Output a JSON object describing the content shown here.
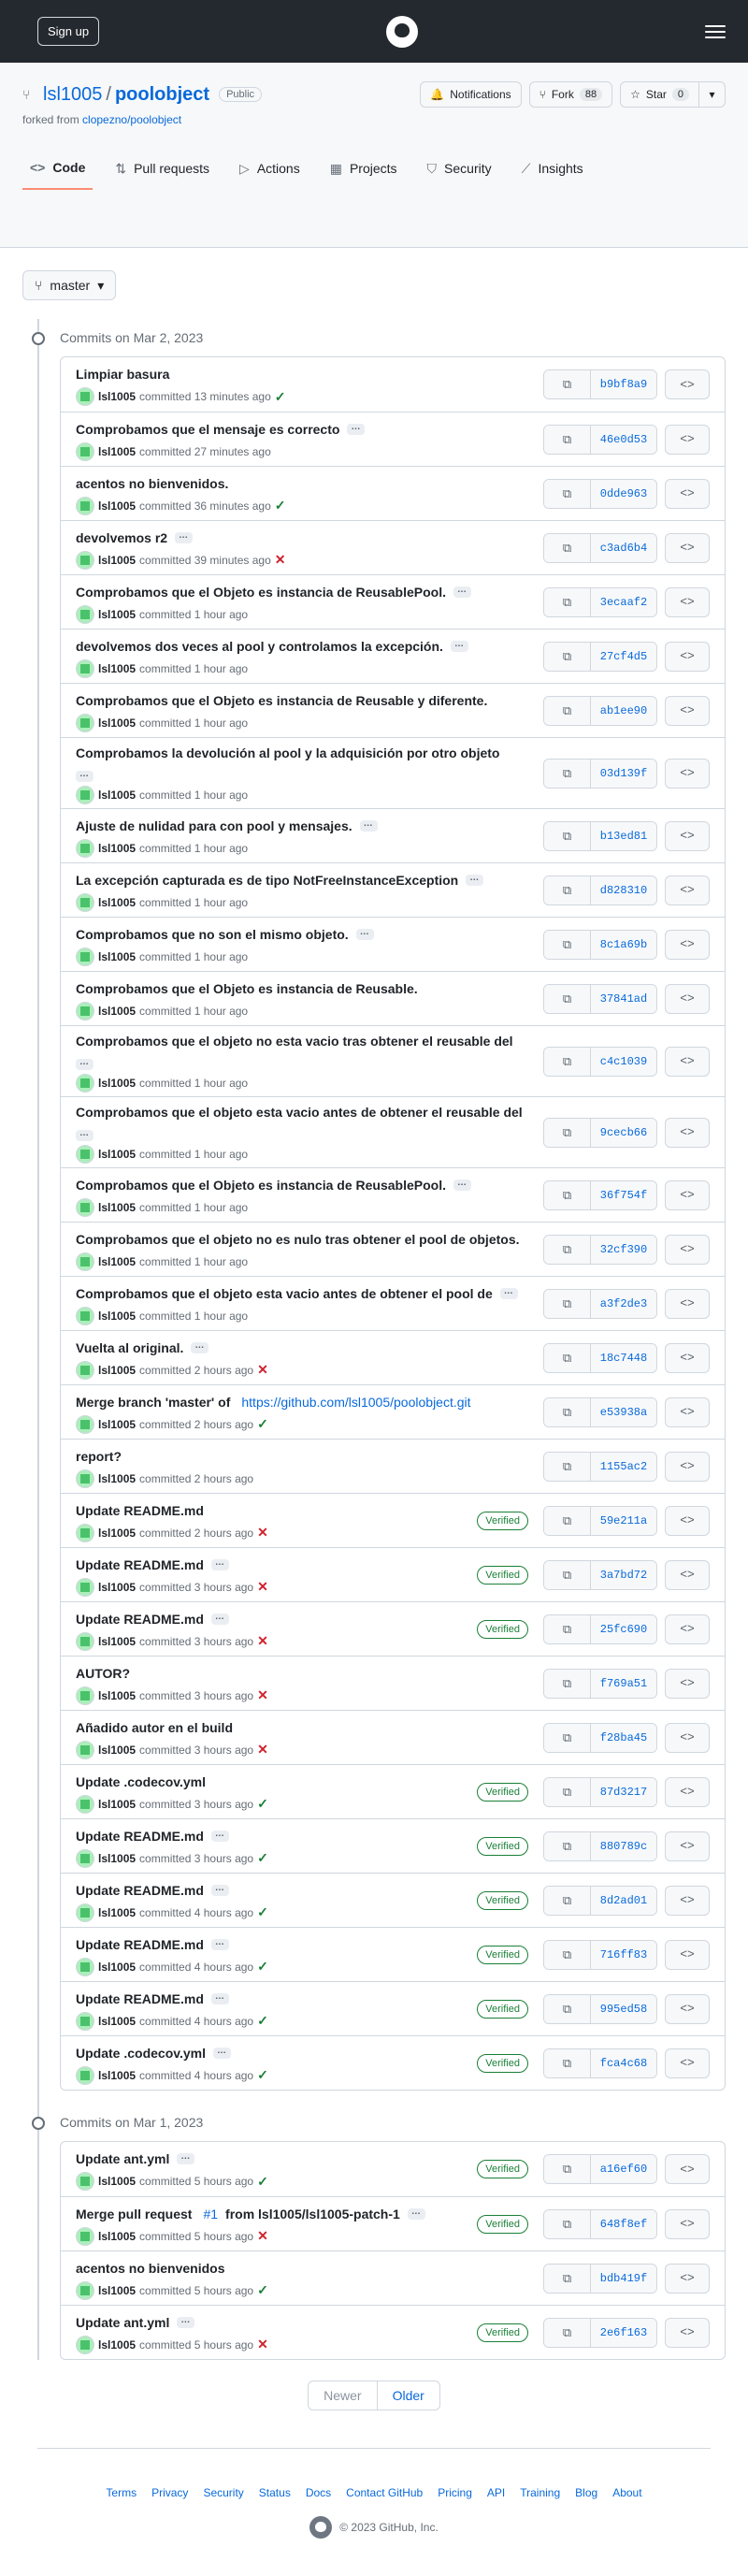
{
  "topbar": {
    "signup": "Sign up"
  },
  "repo": {
    "owner": "lsl1005",
    "separator": "/",
    "name": "poolobject",
    "visibility": "Public",
    "forked_label": "forked from",
    "forked_from": "clopezno/poolobject",
    "notifications": "Notifications",
    "fork": "Fork",
    "fork_count": "88",
    "star": "Star",
    "star_count": "0"
  },
  "tabs": [
    "Code",
    "Pull requests",
    "Actions",
    "Projects",
    "Security",
    "Insights"
  ],
  "branch": "master",
  "groups": [
    {
      "date": "Commits on Mar 2, 2023",
      "commits": [
        {
          "msg": "Limpiar basura",
          "author": "lsl1005",
          "time": "committed 13 minutes ago",
          "status": "ok",
          "sha": "b9bf8a9",
          "ell": false,
          "verified": ""
        },
        {
          "msg": "Comprobamos que el mensaje es correcto",
          "author": "lsl1005",
          "time": "committed 27 minutes ago",
          "status": "",
          "sha": "46e0d53",
          "ell": true,
          "verified": ""
        },
        {
          "msg": "acentos no bienvenidos.",
          "author": "lsl1005",
          "time": "committed 36 minutes ago",
          "status": "ok",
          "sha": "0dde963",
          "ell": false,
          "verified": ""
        },
        {
          "msg": "devolvemos r2",
          "author": "lsl1005",
          "time": "committed 39 minutes ago",
          "status": "fail",
          "sha": "c3ad6b4",
          "ell": true,
          "verified": ""
        },
        {
          "msg": "Comprobamos que el Objeto es instancia de ReusablePool.",
          "author": "lsl1005",
          "time": "committed 1 hour ago",
          "status": "",
          "sha": "3ecaaf2",
          "ell": true,
          "verified": ""
        },
        {
          "msg": "devolvemos dos veces al pool y controlamos la excepción.",
          "author": "lsl1005",
          "time": "committed 1 hour ago",
          "status": "",
          "sha": "27cf4d5",
          "ell": true,
          "verified": ""
        },
        {
          "msg": "Comprobamos que el Objeto es instancia de Reusable y diferente.",
          "author": "lsl1005",
          "time": "committed 1 hour ago",
          "status": "",
          "sha": "ab1ee90",
          "ell": false,
          "verified": ""
        },
        {
          "msg": "Comprobamos la devolución al pool y la adquisición por otro objeto",
          "author": "lsl1005",
          "time": "committed 1 hour ago",
          "status": "",
          "sha": "03d139f",
          "ell": true,
          "wrap": true,
          "verified": ""
        },
        {
          "msg": "Ajuste de nulidad para con pool y mensajes.",
          "author": "lsl1005",
          "time": "committed 1 hour ago",
          "status": "",
          "sha": "b13ed81",
          "ell": true,
          "verified": ""
        },
        {
          "msg": "La excepción capturada es de tipo NotFreeInstanceException",
          "author": "lsl1005",
          "time": "committed 1 hour ago",
          "status": "",
          "sha": "d828310",
          "ell": true,
          "verified": ""
        },
        {
          "msg": "Comprobamos que no son el mismo objeto.",
          "author": "lsl1005",
          "time": "committed 1 hour ago",
          "status": "",
          "sha": "8c1a69b",
          "ell": true,
          "verified": ""
        },
        {
          "msg": "Comprobamos que el Objeto es instancia de Reusable.",
          "author": "lsl1005",
          "time": "committed 1 hour ago",
          "status": "",
          "sha": "37841ad",
          "ell": false,
          "verified": ""
        },
        {
          "msg": "Comprobamos que el objeto no esta vacio tras obtener el reusable del",
          "author": "lsl1005",
          "time": "committed 1 hour ago",
          "status": "",
          "sha": "c4c1039",
          "ell": true,
          "wrap": true,
          "verified": ""
        },
        {
          "msg": "Comprobamos que el objeto esta vacio antes de obtener el reusable del",
          "author": "lsl1005",
          "time": "committed 1 hour ago",
          "status": "",
          "sha": "9cecb66",
          "ell": true,
          "wrap": true,
          "verified": ""
        },
        {
          "msg": "Comprobamos que el Objeto es instancia de ReusablePool.",
          "author": "lsl1005",
          "time": "committed 1 hour ago",
          "status": "",
          "sha": "36f754f",
          "ell": true,
          "verified": ""
        },
        {
          "msg": "Comprobamos que el objeto no es nulo tras obtener el pool de objetos.",
          "author": "lsl1005",
          "time": "committed 1 hour ago",
          "status": "",
          "sha": "32cf390",
          "ell": false,
          "verified": ""
        },
        {
          "msg": "Comprobamos que el objeto esta vacio antes de obtener el pool de",
          "author": "lsl1005",
          "time": "committed 1 hour ago",
          "status": "",
          "sha": "a3f2de3",
          "ell": true,
          "verified": ""
        },
        {
          "msg": "Vuelta al original.",
          "author": "lsl1005",
          "time": "committed 2 hours ago",
          "status": "fail",
          "sha": "18c7448",
          "ell": true,
          "verified": ""
        },
        {
          "msg": "Merge branch 'master' of",
          "link": "https://github.com/lsl1005/poolobject.git",
          "author": "lsl1005",
          "time": "committed 2 hours ago",
          "status": "ok",
          "sha": "e53938a",
          "ell": false,
          "verified": ""
        },
        {
          "msg": "report?",
          "author": "lsl1005",
          "time": "committed 2 hours ago",
          "status": "",
          "sha": "1155ac2",
          "ell": false,
          "verified": ""
        },
        {
          "msg": "Update README.md",
          "author": "lsl1005",
          "time": "committed 2 hours ago",
          "status": "fail",
          "sha": "59e211a",
          "ell": false,
          "verified": "Verified"
        },
        {
          "msg": "Update README.md",
          "author": "lsl1005",
          "time": "committed 3 hours ago",
          "status": "fail",
          "sha": "3a7bd72",
          "ell": true,
          "verified": "Verified"
        },
        {
          "msg": "Update README.md",
          "author": "lsl1005",
          "time": "committed 3 hours ago",
          "status": "fail",
          "sha": "25fc690",
          "ell": true,
          "verified": "Verified"
        },
        {
          "msg": "AUTOR?",
          "author": "lsl1005",
          "time": "committed 3 hours ago",
          "status": "fail",
          "sha": "f769a51",
          "ell": false,
          "verified": ""
        },
        {
          "msg": "Añadido autor en el build",
          "author": "lsl1005",
          "time": "committed 3 hours ago",
          "status": "fail",
          "sha": "f28ba45",
          "ell": false,
          "verified": ""
        },
        {
          "msg": "Update .codecov.yml",
          "author": "lsl1005",
          "time": "committed 3 hours ago",
          "status": "ok",
          "sha": "87d3217",
          "ell": false,
          "verified": "Verified"
        },
        {
          "msg": "Update README.md",
          "author": "lsl1005",
          "time": "committed 3 hours ago",
          "status": "ok",
          "sha": "880789c",
          "ell": true,
          "verified": "Verified"
        },
        {
          "msg": "Update README.md",
          "author": "lsl1005",
          "time": "committed 4 hours ago",
          "status": "ok",
          "sha": "8d2ad01",
          "ell": true,
          "verified": "Verified"
        },
        {
          "msg": "Update README.md",
          "author": "lsl1005",
          "time": "committed 4 hours ago",
          "status": "ok",
          "sha": "716ff83",
          "ell": true,
          "verified": "Verified"
        },
        {
          "msg": "Update README.md",
          "author": "lsl1005",
          "time": "committed 4 hours ago",
          "status": "ok",
          "sha": "995ed58",
          "ell": true,
          "verified": "Verified"
        },
        {
          "msg": "Update .codecov.yml",
          "author": "lsl1005",
          "time": "committed 4 hours ago",
          "status": "ok",
          "sha": "fca4c68",
          "ell": true,
          "verified": "Verified"
        }
      ]
    },
    {
      "date": "Commits on Mar 1, 2023",
      "commits": [
        {
          "msg": "Update ant.yml",
          "author": "lsl1005",
          "time": "committed 5 hours ago",
          "status": "ok",
          "sha": "a16ef60",
          "ell": true,
          "verified": "Verified"
        },
        {
          "msg": "Merge pull request",
          "link": "#1",
          "msg2": "from lsl1005/lsl1005-patch-1",
          "author": "lsl1005",
          "time": "committed 5 hours ago",
          "status": "fail",
          "sha": "648f8ef",
          "ell": true,
          "verified": "Verified"
        },
        {
          "msg": "acentos no bienvenidos",
          "author": "lsl1005",
          "time": "committed 5 hours ago",
          "status": "ok",
          "sha": "bdb419f",
          "ell": false,
          "verified": ""
        },
        {
          "msg": "Update ant.yml",
          "author": "lsl1005",
          "time": "committed 5 hours ago",
          "status": "fail",
          "sha": "2e6f163",
          "ell": true,
          "verified": "Verified"
        }
      ]
    }
  ],
  "pager": {
    "newer": "Newer",
    "older": "Older"
  },
  "footer": {
    "links": [
      "Terms",
      "Privacy",
      "Security",
      "Status",
      "Docs",
      "Contact GitHub",
      "Pricing",
      "API",
      "Training",
      "Blog",
      "About"
    ],
    "copyright": "© 2023 GitHub, Inc."
  },
  "icons": {
    "ok": "✓",
    "fail": "✕",
    "copy": "⧉",
    "browse": "<>",
    "ellipsis": "…"
  }
}
